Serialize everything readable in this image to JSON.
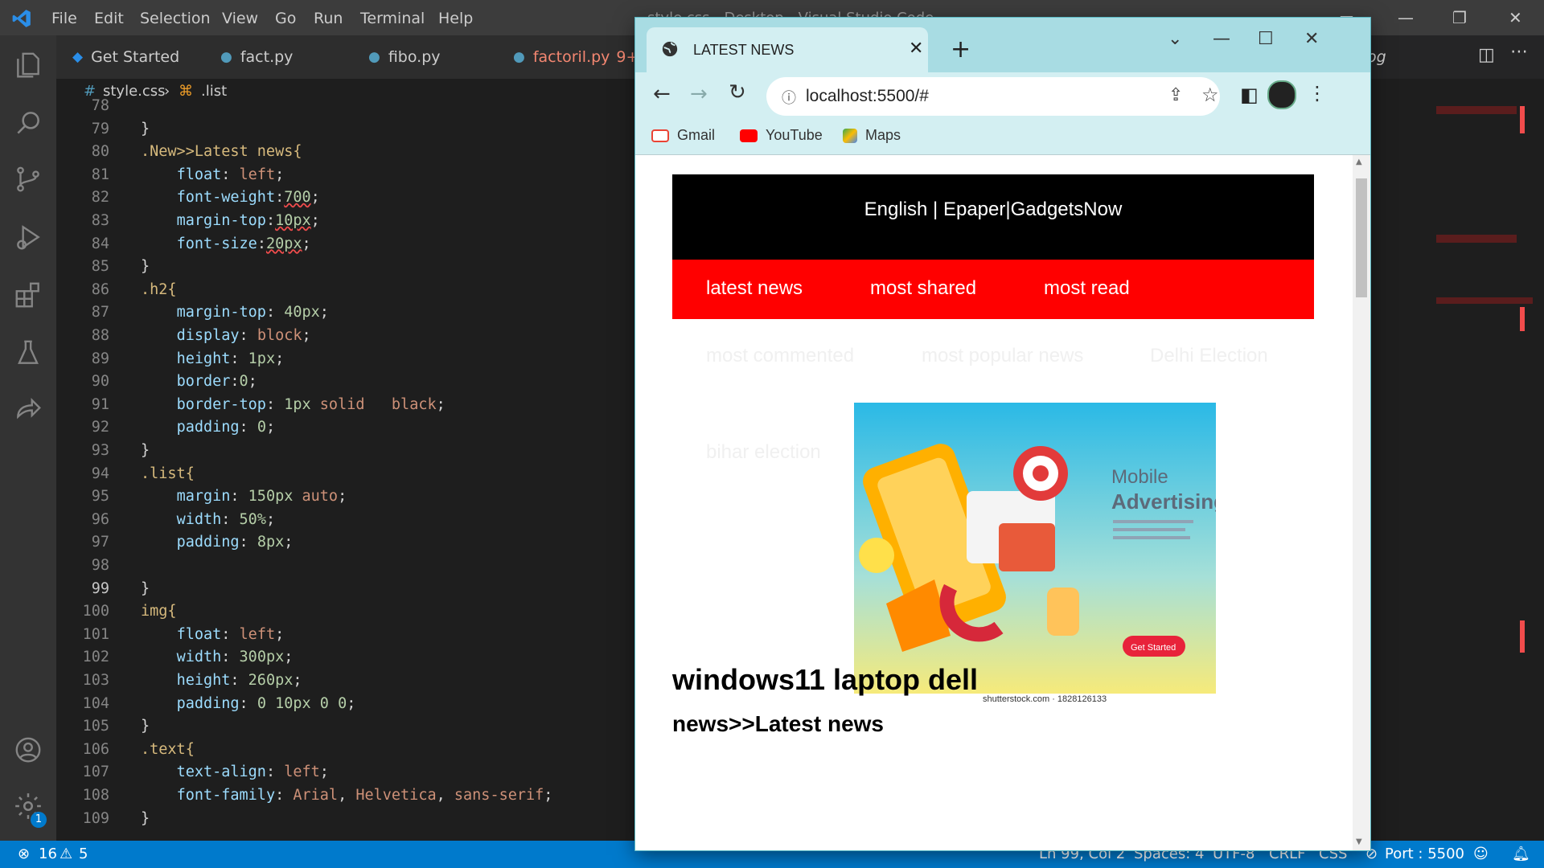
{
  "vscode": {
    "title": "style.css - Desktop - Visual Studio Code",
    "menu": [
      "File",
      "Edit",
      "Selection",
      "View",
      "Go",
      "Run",
      "Terminal",
      "Help"
    ],
    "tabs": [
      {
        "label": "Get Started",
        "badge": ""
      },
      {
        "label": "fact.py",
        "badge": ""
      },
      {
        "label": "fibo.py",
        "badge": ""
      },
      {
        "label": "factoril.py",
        "badge": "9+"
      }
    ],
    "hidden_tab_fragment": "og",
    "breadcrumb": {
      "file": "style.css",
      "symbol": ".list"
    },
    "code_lines": [
      {
        "n": "78",
        "text": ""
      },
      {
        "n": "79",
        "text": "}"
      },
      {
        "n": "80",
        "text": ".New>>Latest news{"
      },
      {
        "n": "81",
        "text": "    float: left;"
      },
      {
        "n": "82",
        "text": "    font-weight:700;"
      },
      {
        "n": "83",
        "text": "    margin-top:10px;"
      },
      {
        "n": "84",
        "text": "    font-size:20px;"
      },
      {
        "n": "85",
        "text": "}"
      },
      {
        "n": "86",
        "text": ".h2{"
      },
      {
        "n": "87",
        "text": "    margin-top: 40px;"
      },
      {
        "n": "88",
        "text": "    display: block;"
      },
      {
        "n": "89",
        "text": "    height: 1px;"
      },
      {
        "n": "90",
        "text": "    border:0;"
      },
      {
        "n": "91",
        "text": "    border-top: 1px solid   black;"
      },
      {
        "n": "92",
        "text": "    padding: 0;"
      },
      {
        "n": "93",
        "text": "}"
      },
      {
        "n": "94",
        "text": ".list{"
      },
      {
        "n": "95",
        "text": "    margin: 150px auto;"
      },
      {
        "n": "96",
        "text": "    width: 50%;"
      },
      {
        "n": "97",
        "text": "    padding: 8px;"
      },
      {
        "n": "98",
        "text": ""
      },
      {
        "n": "99",
        "text": "}"
      },
      {
        "n": "100",
        "text": "img{"
      },
      {
        "n": "101",
        "text": "    float: left;"
      },
      {
        "n": "102",
        "text": "    width: 300px;"
      },
      {
        "n": "103",
        "text": "    height: 260px;"
      },
      {
        "n": "104",
        "text": "    padding: 0 10px 0 0;"
      },
      {
        "n": "105",
        "text": "}"
      },
      {
        "n": "106",
        "text": ".text{"
      },
      {
        "n": "107",
        "text": "    text-align: left;"
      },
      {
        "n": "108",
        "text": "    font-family: Arial, Helvetica, sans-serif;"
      },
      {
        "n": "109",
        "text": "}"
      }
    ],
    "status": {
      "errors": "16",
      "warnings": "5",
      "position": "Ln 99, Col 2",
      "spaces": "Spaces: 4",
      "encoding": "UTF-8",
      "eol": "CRLF",
      "language": "CSS",
      "port": "Port : 5500"
    },
    "settings_badge": "1",
    "colors": {
      "accent": "#007acc",
      "titlebar": "#3c3c3c",
      "editor": "#1e1e1e"
    }
  },
  "browser": {
    "tab_title": "LATEST NEWS",
    "url": "localhost:5500/#",
    "bookmarks": [
      "Gmail",
      "YouTube",
      "Maps"
    ],
    "page": {
      "top_bar": "English | Epaper|GadgetsNow",
      "red_links": [
        "latest news",
        "most shared",
        "most read"
      ],
      "faint_links": [
        "most commented",
        "most popular news",
        "Delhi Election",
        "bihar election"
      ],
      "ad": {
        "title_line1": "Mobile",
        "title_line2": "Advertising",
        "button": "Get Started",
        "credit": "shutterstock.com · 1828126133"
      },
      "heading": "windows11 laptop dell",
      "subheading": "news>>Latest news"
    },
    "colors": {
      "frame": "#a8dce3",
      "red": "#ff0000",
      "black": "#000000"
    }
  }
}
